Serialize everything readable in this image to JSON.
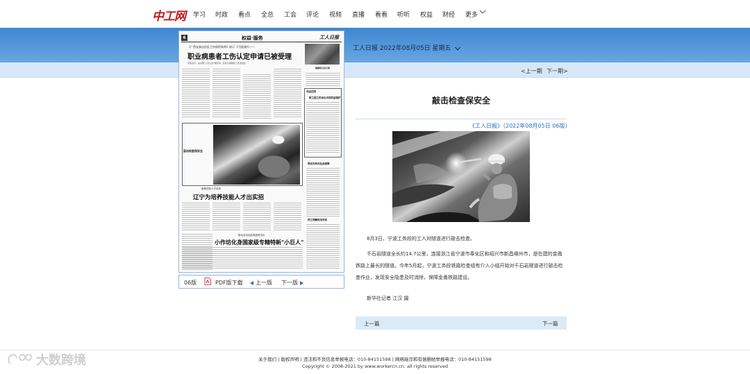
{
  "site": {
    "logo": "中工网",
    "nav": [
      "学习",
      "时政",
      "看点",
      "全总",
      "工会",
      "评论",
      "视频",
      "直播",
      "看看",
      "听听",
      "权益",
      "财经",
      "更多"
    ]
  },
  "issue": {
    "date_label": "工人日报 2022年08月05日 星期五",
    "prev_issue": "<上一期",
    "next_issue": "下一期>"
  },
  "paper": {
    "page_num": "6",
    "section": "权益·服务",
    "masthead": "工人日报",
    "kicker": "《广西壮族自治区工伤保险条例》修订 下月起施行——",
    "headline": "职业病患者工伤认定申请已被受理",
    "subtitle": "专家表示，在办理\"工伤认定\"程序中，应充分保障职工合法权益",
    "top_image_caption": "健康知识进万家",
    "photo_caption": "敲击检查保安全",
    "liaoning_kicker": "聚焦技能人才培育",
    "liaoning_headline": "辽宁为培养技能人才出实招",
    "small_kicker": "推动劳动技能竞赛常态化",
    "small_headline": "小作坊化身国家级专精特新\"小巨人\"",
    "right_heads": [
      "法治在线",
      "职工因工伤诉讼中的权益保护",
      "劳动关系与社会保障",
      "同工同酬有法可依"
    ]
  },
  "toolbar": {
    "page": "06版",
    "pdf_download": "PDF版下载",
    "prev_page": "上一版",
    "next_page": "下一版"
  },
  "article": {
    "title": "敲击检查保安全",
    "source": "《工人日报》（2022年08月05日 06版）",
    "paragraphs": [
      "8月3日，宁波工务段的工人对隧道进行敲击检查。",
      "千石岩隧道全长约14.7公里，连接浙江省宁波市奉化区和绍兴市新昌嵊州市，是在建的金甬铁路上最长的隧道。今年5月起，宁波工务段铁路检查组有介入小组开始对千石岩隧道进行敲击检查作业，发现安全隐患及时消除，保障金甬铁路建设。"
    ],
    "byline": "新华社记者 江汉 摄",
    "prev_article": "上一篇",
    "next_article": "下一篇"
  },
  "footer": {
    "links": "关于我们 | 版权声明 | 违法和不良信息举报电话：010-84151598 | 网络敲诈和有偿删帖举报电话：010-84151598",
    "copyright": "Copyright © 2008-2021 by www.workercn.cn. all rights reserved"
  },
  "watermark": "大数跨境",
  "colors": {
    "brand_red": "#c8161d",
    "band_blue": "#3f87d2",
    "band_light": "#d6e8f7",
    "link_blue": "#2a6fc2"
  }
}
